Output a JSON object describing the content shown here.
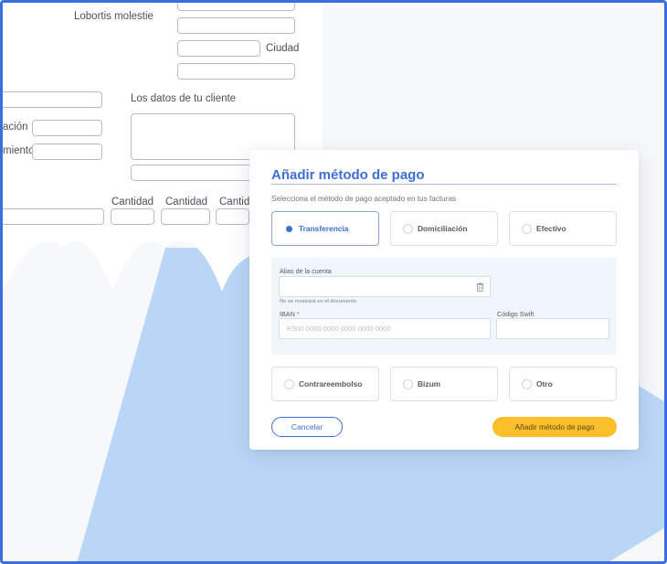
{
  "background_form": {
    "labels": {
      "lobortis": "Lobortis molestie",
      "ciudad": "Ciudad",
      "cliente": "Los datos de tu cliente",
      "cion": "ación",
      "miento": "miento",
      "cantidad_1": "Cantidad",
      "cantidad_2": "Cantidad",
      "cantidad_3": "Cantid"
    }
  },
  "modal": {
    "title": "Añadir método de pago",
    "subtitle": "Selecciona el método de pago aceptado en tus facturas",
    "options_top": [
      {
        "label": "Transferencia",
        "selected": true
      },
      {
        "label": "Domiciliación",
        "selected": false
      },
      {
        "label": "Efectivo",
        "selected": false
      }
    ],
    "options_bottom": [
      {
        "label": "Contrareembolso",
        "selected": false
      },
      {
        "label": "Bizum",
        "selected": false
      },
      {
        "label": "Otro",
        "selected": false
      }
    ],
    "fields": {
      "alias_label": "Alias de la cuenta",
      "alias_value": "",
      "alias_help": "No se mostrará en el documento",
      "iban_label": "IBAN",
      "iban_required": "*",
      "iban_placeholder": "ES00 0000 0000 0000 0000 0000",
      "swift_label": "Código Swift",
      "swift_value": ""
    },
    "cancel_label": "Cancelar",
    "submit_label": "Añadir método de pago"
  },
  "colors": {
    "accent": "#3d6fd6",
    "cta": "#fbbf2c",
    "frame": "#3b6fe0",
    "decor_blue": "#bad6f7"
  },
  "icons": {
    "alias_action": "trash-icon"
  }
}
